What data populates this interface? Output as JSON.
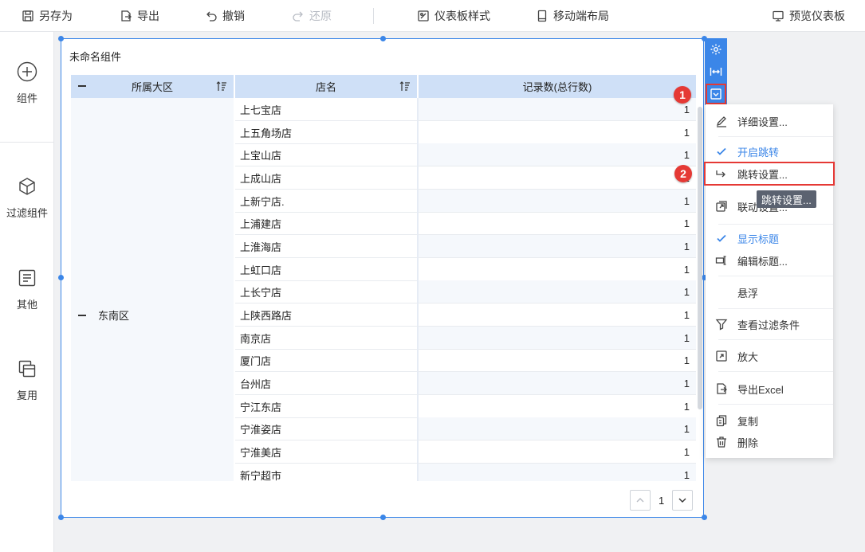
{
  "toolbar": {
    "save_as": "另存为",
    "export": "导出",
    "undo": "撤销",
    "redo": "还原",
    "dashboard_style": "仪表板样式",
    "mobile_layout": "移动端布局",
    "preview": "预览仪表板"
  },
  "sidebar": {
    "components": "组件",
    "filter_components": "过滤组件",
    "other": "其他",
    "reuse": "复用"
  },
  "widget": {
    "title": "未命名组件",
    "columns": [
      "所属大区",
      "店名",
      "记录数(总行数)"
    ],
    "region": "东南区",
    "rows": [
      {
        "shop": "上七宝店",
        "count": "1"
      },
      {
        "shop": "上五角场店",
        "count": "1"
      },
      {
        "shop": "上宝山店",
        "count": "1"
      },
      {
        "shop": "上成山店",
        "count": "1"
      },
      {
        "shop": "上新宁店.",
        "count": "1"
      },
      {
        "shop": "上浦建店",
        "count": "1"
      },
      {
        "shop": "上淮海店",
        "count": "1"
      },
      {
        "shop": "上虹口店",
        "count": "1"
      },
      {
        "shop": "上长宁店",
        "count": "1"
      },
      {
        "shop": "上陕西路店",
        "count": "1"
      },
      {
        "shop": "南京店",
        "count": "1"
      },
      {
        "shop": "厦门店",
        "count": "1"
      },
      {
        "shop": "台州店",
        "count": "1"
      },
      {
        "shop": "宁江东店",
        "count": "1"
      },
      {
        "shop": "宁淮姿店",
        "count": "1"
      },
      {
        "shop": "宁淮美店",
        "count": "1"
      },
      {
        "shop": "新宁超市",
        "count": "1"
      }
    ],
    "page": "1"
  },
  "badges": {
    "one": "1",
    "two": "2"
  },
  "menu": {
    "detail_settings": "详细设置...",
    "enable_jump": "开启跳转",
    "jump_settings": "跳转设置...",
    "linkage_settings": "联动设置...",
    "show_title": "显示标题",
    "edit_title": "编辑标题...",
    "float": "悬浮",
    "view_filter": "查看过滤条件",
    "zoom": "放大",
    "export_excel": "导出Excel",
    "copy": "复制",
    "delete": "删除"
  },
  "tooltip": "跳转设置...",
  "colors": {
    "accent": "#3b86e8",
    "highlight": "#e53935",
    "header_bg": "#cfe0f7"
  }
}
